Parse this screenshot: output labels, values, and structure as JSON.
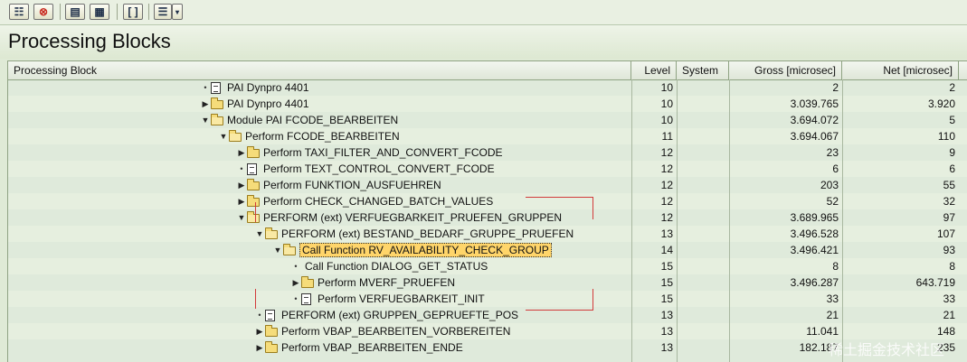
{
  "title": "Processing Blocks",
  "columns": {
    "block": "Processing Block",
    "level": "Level",
    "system": "System",
    "gross": "Gross [microsec]",
    "net": "Net [microsec]"
  },
  "rows": [
    {
      "indent": 0,
      "expander": "bullet",
      "icon": "document-icon",
      "label": "PAI Dynpro 4401",
      "level": "10",
      "system": "",
      "gross": "2",
      "net": "2"
    },
    {
      "indent": 0,
      "expander": "collapsed",
      "icon": "folder-icon",
      "label": "PAI Dynpro 4401",
      "level": "10",
      "system": "",
      "gross": "3.039.765",
      "net": "3.920"
    },
    {
      "indent": 0,
      "expander": "expanded",
      "icon": "open-folder-icon",
      "label": "Module PAI FCODE_BEARBEITEN",
      "level": "10",
      "system": "",
      "gross": "3.694.072",
      "net": "5"
    },
    {
      "indent": 1,
      "expander": "expanded",
      "icon": "open-folder-icon",
      "label": "Perform FCODE_BEARBEITEN",
      "level": "11",
      "system": "",
      "gross": "3.694.067",
      "net": "110"
    },
    {
      "indent": 2,
      "expander": "collapsed",
      "icon": "folder-icon",
      "label": "Perform TAXI_FILTER_AND_CONVERT_FCODE",
      "level": "12",
      "system": "",
      "gross": "23",
      "net": "9"
    },
    {
      "indent": 2,
      "expander": "bullet",
      "icon": "document-icon",
      "label": "Perform TEXT_CONTROL_CONVERT_FCODE",
      "level": "12",
      "system": "",
      "gross": "6",
      "net": "6"
    },
    {
      "indent": 2,
      "expander": "collapsed",
      "icon": "folder-icon",
      "label": "Perform FUNKTION_AUSFUEHREN",
      "level": "12",
      "system": "",
      "gross": "203",
      "net": "55"
    },
    {
      "indent": 2,
      "expander": "collapsed",
      "icon": "folder-icon",
      "label": "Perform CHECK_CHANGED_BATCH_VALUES",
      "level": "12",
      "system": "",
      "gross": "52",
      "net": "32"
    },
    {
      "indent": 2,
      "expander": "expanded",
      "icon": "open-folder-icon",
      "label": "PERFORM (ext) VERFUEGBARKEIT_PRUEFEN_GRUPPEN",
      "level": "12",
      "system": "",
      "gross": "3.689.965",
      "net": "97"
    },
    {
      "indent": 3,
      "expander": "expanded",
      "icon": "open-folder-icon",
      "label": "PERFORM (ext) BESTAND_BEDARF_GRUPPE_PRUEFEN",
      "level": "13",
      "system": "",
      "gross": "3.496.528",
      "net": "107"
    },
    {
      "indent": 4,
      "expander": "expanded",
      "icon": "open-folder-icon",
      "label": "Call Function RV_AVAILABILITY_CHECK_GROUP",
      "level": "14",
      "system": "",
      "gross": "3.496.421",
      "net": "93",
      "highlight": true
    },
    {
      "indent": 5,
      "expander": "bullet",
      "icon": "none",
      "label": "Call Function DIALOG_GET_STATUS",
      "level": "15",
      "system": "",
      "gross": "8",
      "net": "8"
    },
    {
      "indent": 5,
      "expander": "collapsed",
      "icon": "folder-icon",
      "label": "Perform MVERF_PRUEFEN",
      "level": "15",
      "system": "",
      "gross": "3.496.287",
      "net": "643.719"
    },
    {
      "indent": 5,
      "expander": "bullet",
      "icon": "document-icon",
      "label": "Perform VERFUEGBARKEIT_INIT",
      "level": "15",
      "system": "",
      "gross": "33",
      "net": "33"
    },
    {
      "indent": 3,
      "expander": "bullet",
      "icon": "document-icon",
      "label": "PERFORM (ext) GRUPPEN_GEPRUEFTE_POS",
      "level": "13",
      "system": "",
      "gross": "21",
      "net": "21"
    },
    {
      "indent": 3,
      "expander": "collapsed",
      "icon": "folder-icon",
      "label": "Perform VBAP_BEARBEITEN_VORBEREITEN",
      "level": "13",
      "system": "",
      "gross": "11.041",
      "net": "148"
    },
    {
      "indent": 3,
      "expander": "collapsed",
      "icon": "folder-icon",
      "label": "Perform VBAP_BEARBEITEN_ENDE",
      "level": "13",
      "system": "",
      "gross": "182.187",
      "net": "235"
    }
  ],
  "watermark": "稀土掘金技术社区"
}
